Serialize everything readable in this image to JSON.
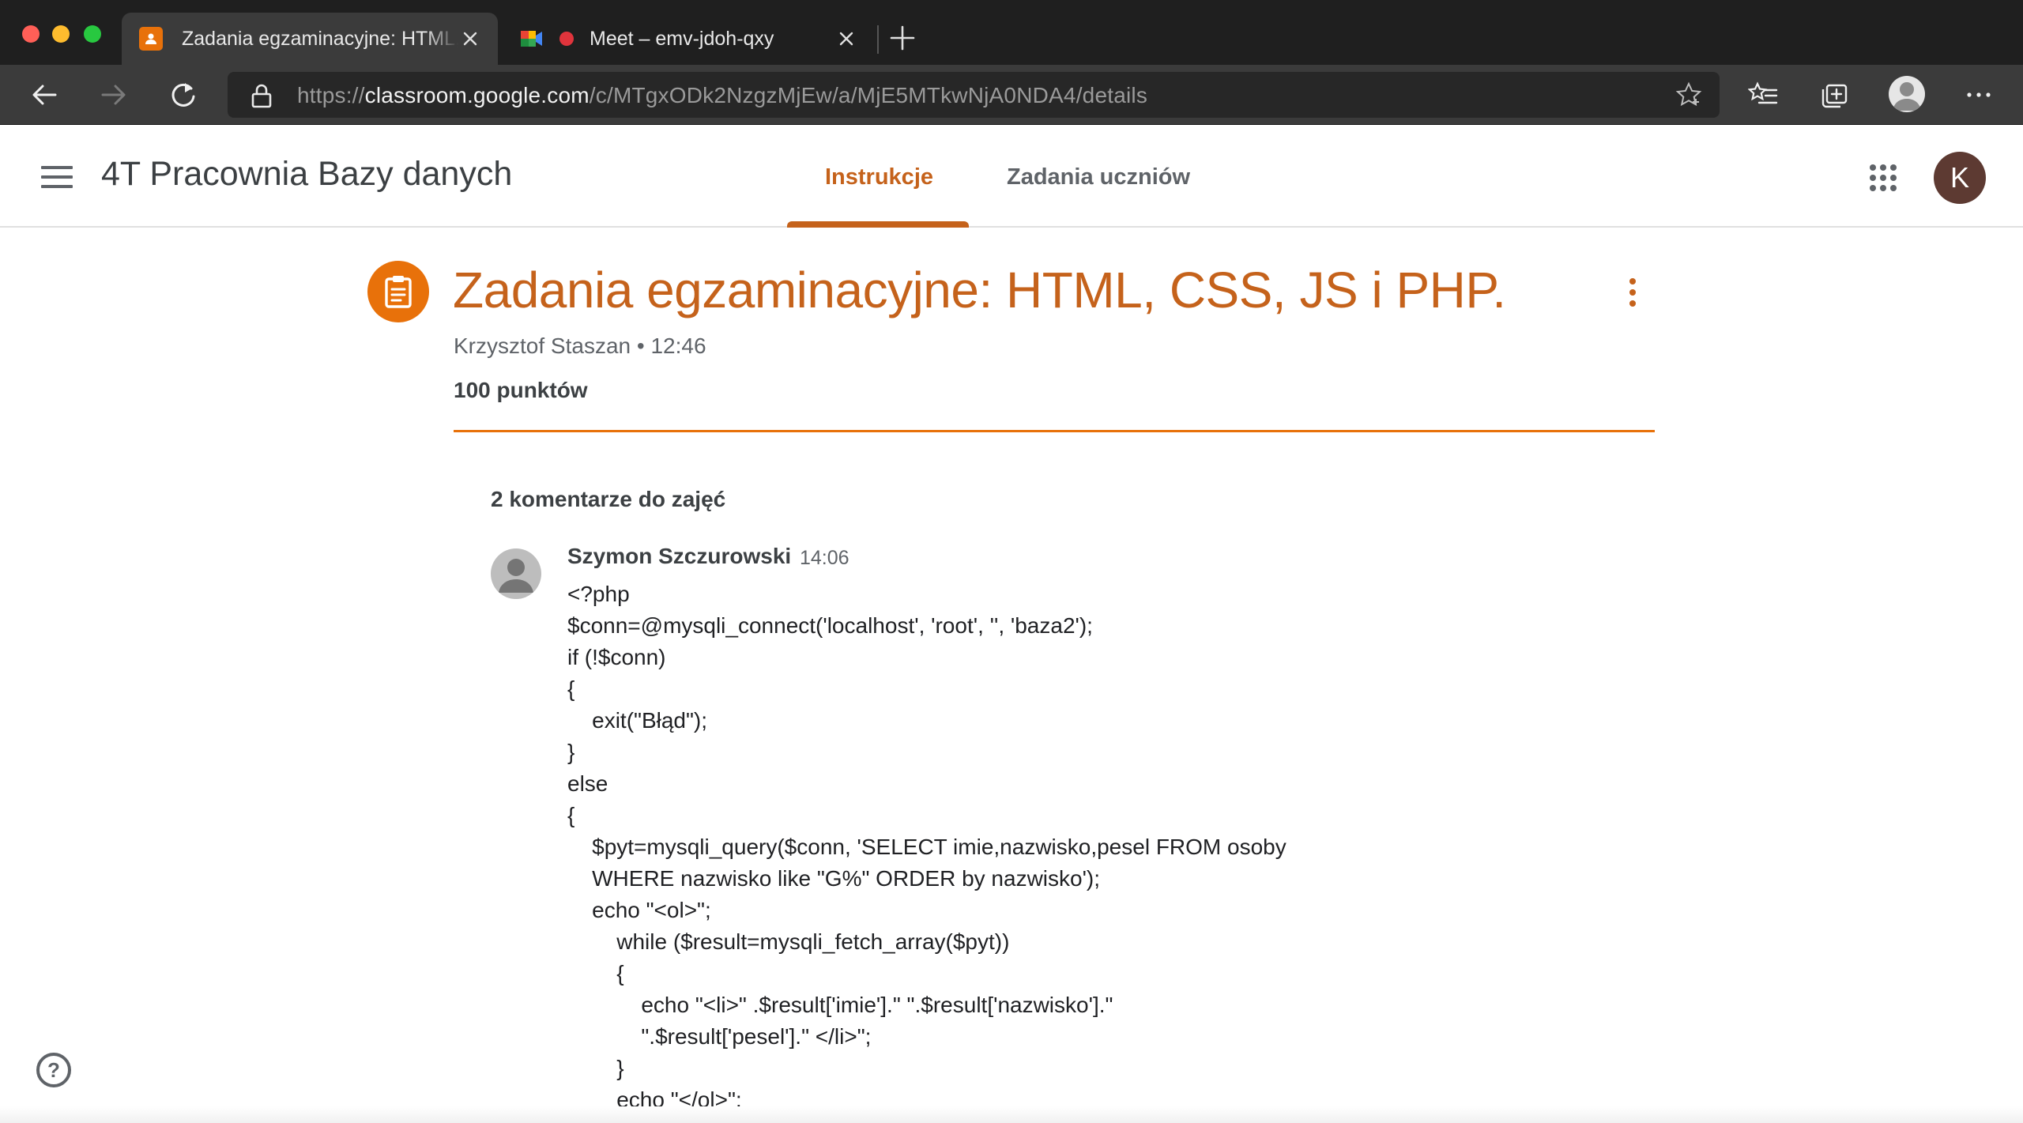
{
  "browser": {
    "tabs": [
      {
        "title": "Zadania egzaminacyjne: HTML, CSS, JS i PHP.",
        "icon": "classroom-icon",
        "active": true
      },
      {
        "title": "Meet – emv-jdoh-qxy",
        "icon": "meet-icon",
        "recording": true,
        "active": false
      }
    ],
    "url": {
      "scheme": "https://",
      "host": "classroom.google.com",
      "path": "/c/MTgxODk2NzgzMjEw/a/MjE5MTkwNjA0NDA4/details"
    }
  },
  "header": {
    "class_name": "4T Pracownia Bazy danych",
    "tabs": [
      "Instrukcje",
      "Zadania uczniów"
    ],
    "active_tab": "Instrukcje",
    "user_initial": "K"
  },
  "assignment": {
    "title": "Zadania egzaminacyjne: HTML, CSS, JS i PHP.",
    "author": "Krzysztof Staszan",
    "separator": "•",
    "time": "12:46",
    "points": "100 punktów"
  },
  "comments": {
    "count_label": "2 komentarze do zajęć",
    "items": [
      {
        "author": "Szymon Szczurowski",
        "time": "14:06",
        "lines": [
          "<?php",
          "$conn=@mysqli_connect('localhost', 'root', '', 'baza2');",
          "if (!$conn)",
          "{",
          "    exit(\"Błąd\");",
          "}",
          "else",
          "{",
          "    $pyt=mysqli_query($conn, 'SELECT imie,nazwisko,pesel FROM osoby",
          "    WHERE nazwisko like \"G%\" ORDER by nazwisko');",
          "    echo \"<ol>\";",
          "        while ($result=mysqli_fetch_array($pyt))",
          "        {",
          "            echo \"<li>\" .$result['imie'].\" \".$result['nazwisko'].\"",
          "            \".$result['pesel'].\" </li>\";",
          "        }",
          "        echo \"</ol>\";"
        ]
      }
    ]
  },
  "colors": {
    "accent": "#c5621b",
    "assignment_icon": "#e8710a",
    "tab_bar": "#1f1f1f",
    "toolbar": "#3b3b3b"
  }
}
